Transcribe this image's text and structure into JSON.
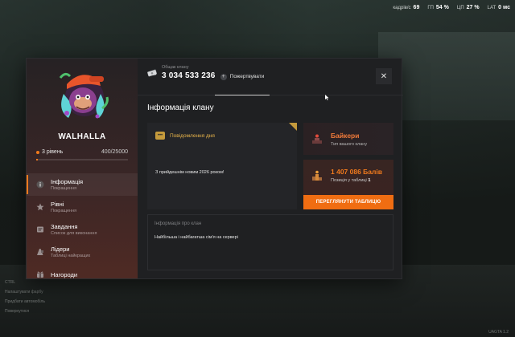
{
  "hud": {
    "items": [
      {
        "label": "кадрів/с",
        "value": "69"
      },
      {
        "label": "ГП",
        "value": "54 %"
      },
      {
        "label": "ЦП",
        "value": "27 %"
      },
      {
        "label": "LAT",
        "value": "0 мс"
      }
    ]
  },
  "background": {
    "list": [
      "CTRL",
      "Налаштувати фарбу",
      "Придбати автомобіль",
      "Повернутися"
    ],
    "fps": "UAGTA 1.2"
  },
  "clan": {
    "name": "WALHALLA",
    "level_label": "3 рівень",
    "xp": "400/25000",
    "xp_fraction": 0.016
  },
  "nav": [
    {
      "title": "Інформація",
      "sub": "Покращення",
      "icon": "info-icon",
      "active": true
    },
    {
      "title": "Рівні",
      "sub": "Покращення",
      "icon": "star-icon",
      "active": false
    },
    {
      "title": "Завдання",
      "sub": "Список для виконання",
      "icon": "task-icon",
      "active": false
    },
    {
      "title": "Лідери",
      "sub": "Таблиці найкращих",
      "icon": "leaders-icon",
      "active": false
    },
    {
      "title": "Нагороди",
      "sub": "",
      "icon": "reward-icon",
      "active": false
    }
  ],
  "topbar": {
    "total_label": "Общак клану",
    "total_value": "3 034 533 236",
    "donate_label": "Пожертвувати",
    "close_icon": "close-icon"
  },
  "section_title": "Інформація клану",
  "motd": {
    "title": "Повідомлення дня",
    "text": "З прийдешнім новим 2026 роком!"
  },
  "clan_type": {
    "title": "Байкери",
    "sub": "Тип вашого клану"
  },
  "rank": {
    "value": "1 407 086 Балів",
    "pos_label": "Позиція у таблиці",
    "pos_value": "1",
    "button": "ПЕРЕГЛЯНУТИ ТАБЛИЦЮ"
  },
  "info": {
    "label": "Інформація про клан",
    "text": "Найбільша і найбагатша сім'я на сервері"
  },
  "colors": {
    "accent": "#f06d12",
    "gold": "#c49a3c",
    "panel": "#1f2022"
  }
}
